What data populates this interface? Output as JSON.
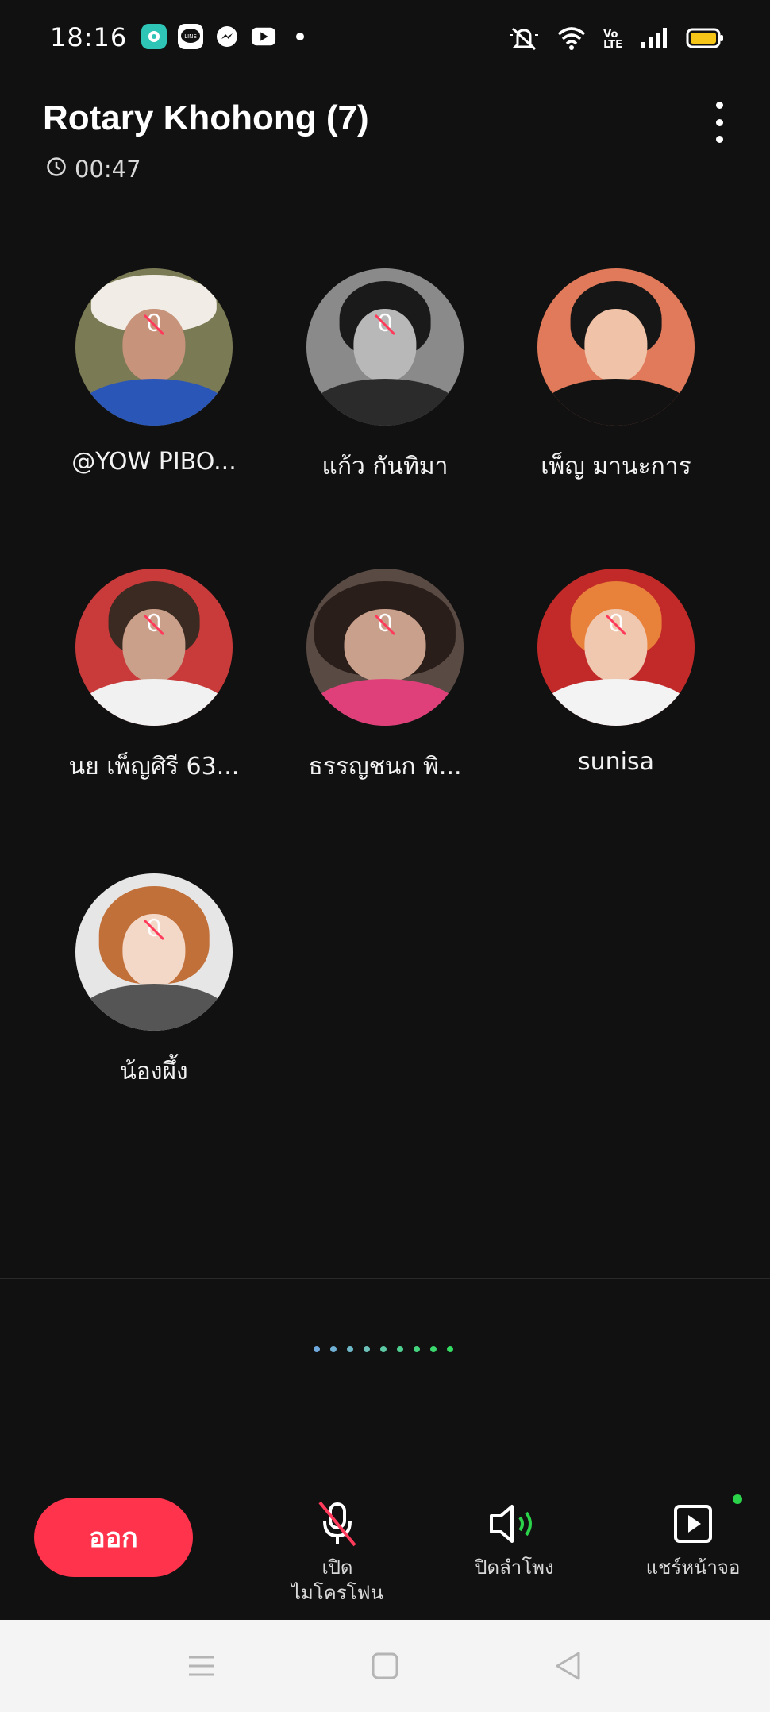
{
  "status_bar": {
    "time": "18:16",
    "notification_icons": [
      "chat-bubble-icon",
      "line-icon",
      "messenger-icon",
      "youtube-icon",
      "more-dot-icon"
    ],
    "system_icons": [
      "silent-bell-icon",
      "wifi-icon",
      "volte-icon",
      "signal-icon",
      "battery-icon"
    ],
    "volte_label": "Vo LTE"
  },
  "header": {
    "title": "Rotary Khohong (7)",
    "duration": "00:47",
    "more_icon": "more-vertical-icon"
  },
  "participants": [
    {
      "name": "@YOW PIBO...",
      "muted": true
    },
    {
      "name": "แก้ว กันทิมา",
      "muted": true
    },
    {
      "name": "เพ็ญ มานะการ",
      "muted": false
    },
    {
      "name": "นย เพ็ญศิรี 63...",
      "muted": true
    },
    {
      "name": "ธรรญชนก  พิ...",
      "muted": true
    },
    {
      "name": "sunisa",
      "muted": true
    },
    {
      "name": "น้องผึ้ง",
      "muted": true
    }
  ],
  "controls": {
    "leave_label": "ออก",
    "mic_label_line1": "เปิด",
    "mic_label_line2": "ไมโครโฟน",
    "speaker_label": "ปิดลำโพง",
    "share_label": "แชร์หน้าจอ"
  },
  "colors": {
    "background": "#111111",
    "leave_button": "#ff334b",
    "mute_slash": "#ff3b5c",
    "speaker_wave": "#2bd34a",
    "share_dot": "#2bd34a"
  },
  "nav_bar": {
    "icons": [
      "menu-icon",
      "home-icon",
      "back-icon"
    ]
  }
}
